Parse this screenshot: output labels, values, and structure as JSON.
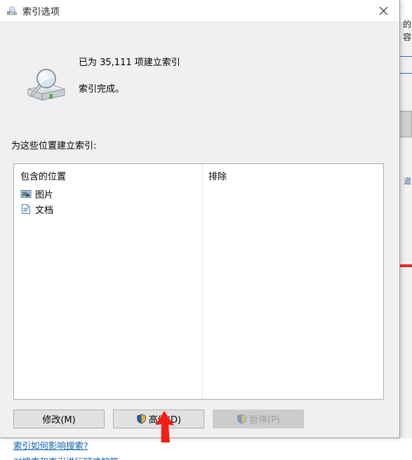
{
  "window": {
    "title": "索引选项",
    "title_icon": "indexing-options-icon",
    "close_label": "✕"
  },
  "status": {
    "line1": "已为 35,111 项建立索引",
    "line2": "索引完成。",
    "icon": "hard-drive-search-icon",
    "indexed_count": "35,111"
  },
  "locations": {
    "label": "为这些位置建立索引:",
    "columns": [
      "包含的位置",
      "排除"
    ],
    "items": [
      {
        "label": "图片",
        "icon": "pictures-icon",
        "excluded": ""
      },
      {
        "label": "文档",
        "icon": "documents-icon",
        "excluded": ""
      }
    ]
  },
  "buttons": [
    {
      "name": "modify",
      "label": "修改(M)",
      "shield": false,
      "disabled": false
    },
    {
      "name": "advanced",
      "label": "高级(D)",
      "shield": true,
      "disabled": false
    },
    {
      "name": "pause",
      "label": "暂停(P)",
      "shield": true,
      "disabled": true
    }
  ],
  "links": {
    "help": "索引如何影响搜索?",
    "help_secondary": "对搜索和索引进行疑难解答"
  },
  "annotation": {
    "arrow_color": "#f51e17",
    "points_to": "高级(D)"
  },
  "background": {
    "chars": [
      "的",
      "容"
    ],
    "accent_blue": "#2a6fc4",
    "accent_red": "#e8262a"
  },
  "colors": {
    "dialog_bg": "#f0f0f0",
    "titlebar_bg": "#ffffff",
    "listbox_bg": "#ffffff",
    "button_bg": "#e1e1e1",
    "link": "#0a5fb4"
  }
}
